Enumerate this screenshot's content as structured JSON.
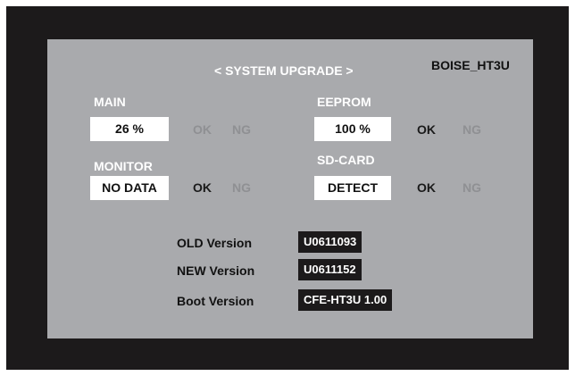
{
  "header": {
    "title": "< SYSTEM UPGRADE >",
    "model": "BOISE_HT3U"
  },
  "main": {
    "label": "MAIN",
    "value": "26 %",
    "ok": "OK",
    "ng": "NG"
  },
  "eeprom": {
    "label": "EEPROM",
    "value": "100 %",
    "ok": "OK",
    "ng": "NG"
  },
  "monitor": {
    "label": "MONITOR",
    "value": "NO DATA",
    "ok": "OK",
    "ng": "NG"
  },
  "sdcard": {
    "label": "SD-CARD",
    "value": "DETECT",
    "ok": "OK",
    "ng": "NG"
  },
  "versions": {
    "old_label": "OLD Version",
    "old_value": "U0611093",
    "new_label": "NEW Version",
    "new_value": "U0611152",
    "boot_label": "Boot Version",
    "boot_value": "CFE-HT3U 1.00"
  },
  "colors": {
    "background": "#1c1a1b",
    "panel": "#a9aaad",
    "value_box": "#ffffff",
    "version_box": "#1c1a1b",
    "status_active": "#1a1a1a",
    "status_inactive": "#8f9093"
  }
}
